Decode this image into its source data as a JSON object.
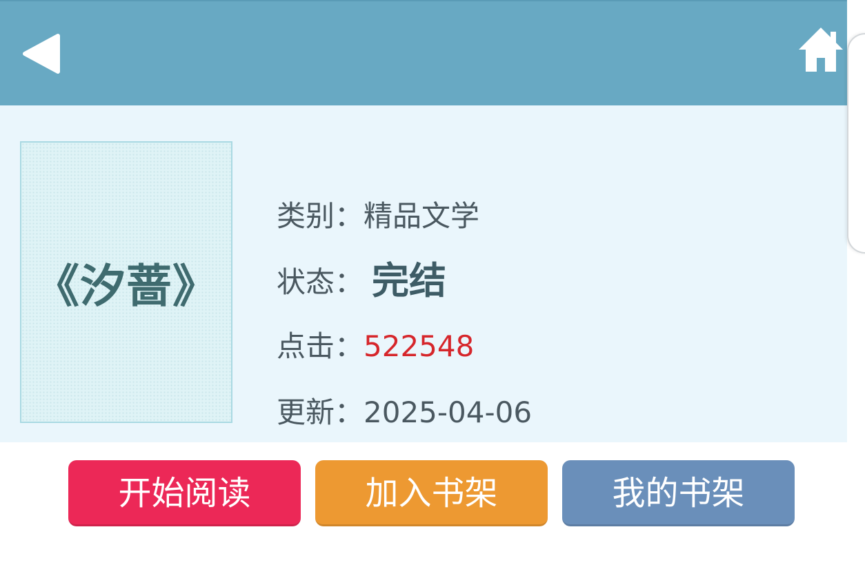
{
  "header": {
    "title": "",
    "back_icon": "back-arrow-icon",
    "home_icon": "home-icon",
    "background_color": "#68a9c3"
  },
  "book": {
    "cover_title": "《汐蔷》",
    "category_label": "类别：",
    "category_value": "精品文学",
    "status_label": "状态：",
    "status_value": "完结",
    "clicks_label": "点击：",
    "clicks_value": "522548",
    "updated_label": "更新：",
    "updated_value": "2025-04-06"
  },
  "actions": {
    "start_reading": "开始阅读",
    "add_to_shelf": "加入书架",
    "my_shelf": "我的书架"
  },
  "colors": {
    "panel_background": "#eaf6fc",
    "clicks_color": "#d6262b",
    "start_reading_color": "#ec2857",
    "add_to_shelf_color": "#ed9932",
    "my_shelf_color": "#6a8fba"
  }
}
